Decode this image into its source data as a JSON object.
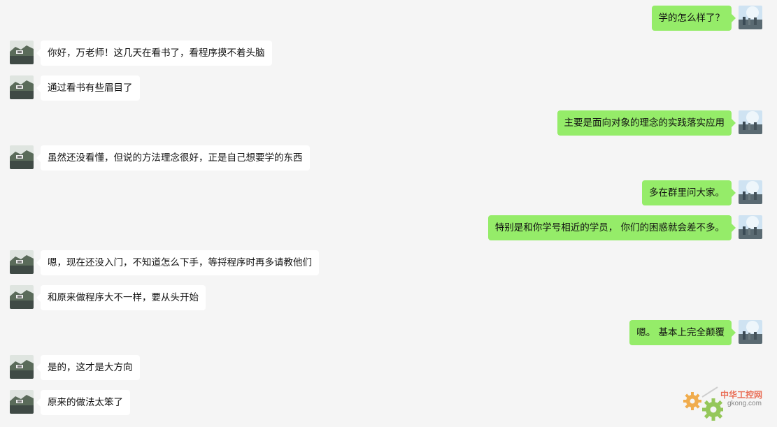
{
  "conversation": {
    "messages": [
      {
        "side": "right",
        "text": "学的怎么样了？",
        "avatar": "sky-avatar"
      },
      {
        "side": "left",
        "text": "你好，万老师！这几天在看书了，看程序摸不着头脑",
        "avatar": "landscape-avatar"
      },
      {
        "side": "left",
        "text": "通过看书有些眉目了",
        "avatar": "landscape-avatar"
      },
      {
        "side": "right",
        "text": "主要是面向对象的理念的实践落实应用",
        "avatar": "sky-avatar"
      },
      {
        "side": "left",
        "text": "虽然还没看懂，但说的方法理念很好，正是自己想要学的东西",
        "avatar": "landscape-avatar"
      },
      {
        "side": "right",
        "text": "多在群里问大家。",
        "avatar": "sky-avatar"
      },
      {
        "side": "right",
        "text": "特别是和你学号相近的学员， 你们的困惑就会差不多。",
        "avatar": "sky-avatar"
      },
      {
        "side": "left",
        "text": "嗯，现在还没入门，不知道怎么下手，等捋程序时再多请教他们",
        "avatar": "landscape-avatar"
      },
      {
        "side": "left",
        "text": "和原来做程序大不一样，要从头开始",
        "avatar": "landscape-avatar"
      },
      {
        "side": "right",
        "text": "嗯。 基本上完全颠覆",
        "avatar": "sky-avatar"
      },
      {
        "side": "left",
        "text": "是的，这才是大方向",
        "avatar": "landscape-avatar"
      },
      {
        "side": "left",
        "text": "原来的做法太笨了",
        "avatar": "landscape-avatar"
      }
    ]
  },
  "watermark": {
    "name": "中华工控网",
    "url": "gkong.com"
  },
  "colors": {
    "background": "#f5f5f5",
    "sent_bubble": "#95ec69",
    "received_bubble": "#ffffff",
    "watermark_orange": "#f0a030",
    "watermark_green": "#8bc34a"
  }
}
